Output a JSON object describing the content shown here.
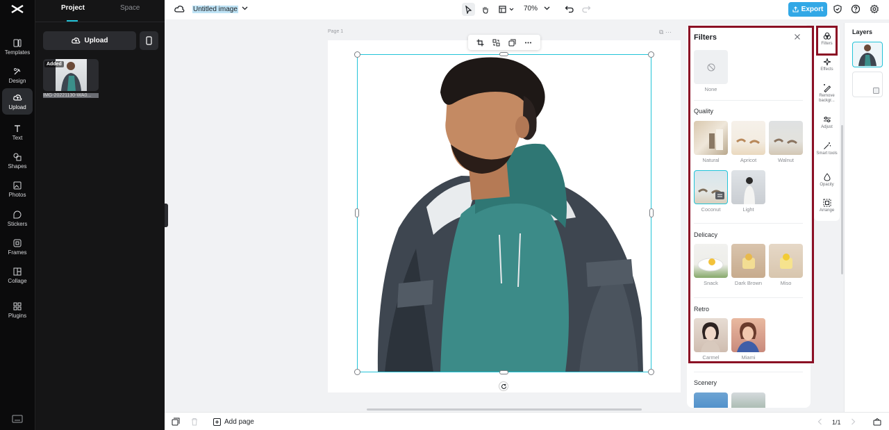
{
  "sidebar": {
    "items": [
      {
        "label": "Templates",
        "icon": "templates-icon"
      },
      {
        "label": "Design",
        "icon": "design-icon"
      },
      {
        "label": "Upload",
        "icon": "upload-cloud-icon",
        "active": true
      },
      {
        "label": "Text",
        "icon": "text-icon"
      },
      {
        "label": "Shapes",
        "icon": "shapes-icon"
      },
      {
        "label": "Photos",
        "icon": "photos-icon"
      },
      {
        "label": "Stickers",
        "icon": "stickers-icon"
      },
      {
        "label": "Frames",
        "icon": "frames-icon"
      },
      {
        "label": "Collage",
        "icon": "collage-icon"
      },
      {
        "label": "Plugins",
        "icon": "plugins-icon"
      }
    ]
  },
  "panel": {
    "tabs": [
      "Project",
      "Space"
    ],
    "upload_label": "Upload",
    "asset": {
      "badge": "Added",
      "filename": "IMG-20221130-WA0..."
    }
  },
  "topbar": {
    "title": "Untitled image",
    "zoom": "70%",
    "export_label": "Export"
  },
  "canvas": {
    "page_label": "Page 1",
    "page_icons": "⧉  ···"
  },
  "filters": {
    "title": "Filters",
    "none_label": "None",
    "sections": [
      {
        "title": "Quality",
        "items": [
          "Natural",
          "Apricot",
          "Walnut",
          "Coconut",
          "Light"
        ]
      },
      {
        "title": "Delicacy",
        "items": [
          "Snack",
          "Dark Brown",
          "Miso"
        ]
      },
      {
        "title": "Retro",
        "items": [
          "Carmel",
          "Miami"
        ]
      },
      {
        "title": "Scenery",
        "items": []
      }
    ]
  },
  "props": [
    {
      "label": "Filters",
      "icon": "filters-icon"
    },
    {
      "label": "Effects",
      "icon": "effects-icon"
    },
    {
      "label": "Remove backgr...",
      "icon": "remove-background-icon"
    },
    {
      "label": "Adjust",
      "icon": "adjust-icon"
    },
    {
      "label": "Smart tools",
      "icon": "smart-tools-icon"
    },
    {
      "label": "Opacity",
      "icon": "opacity-icon"
    },
    {
      "label": "Arrange",
      "icon": "arrange-icon"
    }
  ],
  "layers": {
    "title": "Layers"
  },
  "bottombar": {
    "add_page": "Add page",
    "page_count": "1/1"
  },
  "colors": {
    "accent": "#22c3d8",
    "export": "#32a8e6",
    "highlight": "#8b0f24"
  }
}
